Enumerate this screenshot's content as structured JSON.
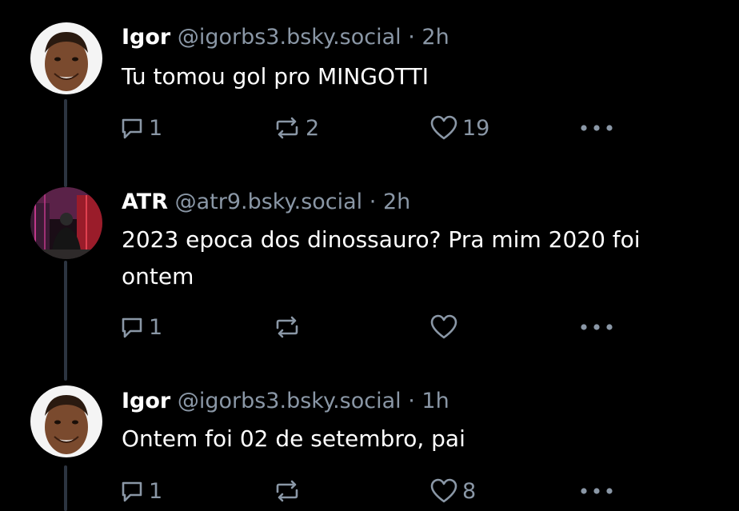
{
  "colors": {
    "background": "#000000",
    "text": "#ffffff",
    "muted": "#8a97a6",
    "thread_line": "#2c3440"
  },
  "posts": [
    {
      "display_name": "Igor",
      "handle": "@igorbs3.bsky.social",
      "separator": "·",
      "time": "2h",
      "text": "Tu tomou gol pro MINGOTTI",
      "reply_count": "1",
      "repost_count": "2",
      "like_count": "19",
      "icons": [
        "reply-icon",
        "repost-icon",
        "like-icon",
        "more-icon"
      ]
    },
    {
      "display_name": "ATR",
      "handle": "@atr9.bsky.social",
      "separator": "·",
      "time": "2h",
      "text": "2023 epoca dos dinossauro? Pra mim 2020 foi ontem",
      "reply_count": "1",
      "repost_count": "",
      "like_count": "",
      "icons": [
        "reply-icon",
        "repost-icon",
        "like-icon",
        "more-icon"
      ]
    },
    {
      "display_name": "Igor",
      "handle": "@igorbs3.bsky.social",
      "separator": "·",
      "time": "1h",
      "text": "Ontem foi 02 de setembro, pai",
      "reply_count": "1",
      "repost_count": "",
      "like_count": "8",
      "icons": [
        "reply-icon",
        "repost-icon",
        "like-icon",
        "more-icon"
      ]
    }
  ]
}
